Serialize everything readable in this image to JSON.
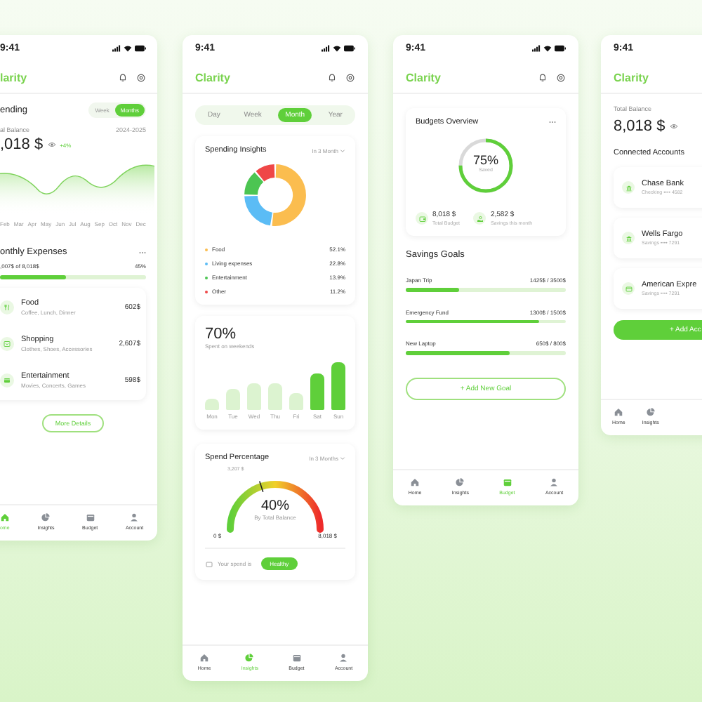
{
  "home": {
    "time": "9:41",
    "title": "larity",
    "section": "ending",
    "toggle": [
      {
        "label": "Week",
        "selected": false
      },
      {
        "label": "Months",
        "selected": true
      }
    ],
    "balance_label": "al Balance",
    "period": "2024-2025",
    "balance": ",018 $",
    "change": "+4%",
    "months": [
      "Feb",
      "Mar",
      "Apr",
      "May",
      "Jun",
      "Jul",
      "Aug",
      "Sep",
      "Oct",
      "Nov",
      "Dec"
    ],
    "expenses": {
      "title": "onthly Expenses",
      "progress_text": ",007$ of 8,018$",
      "percent": "45%",
      "level": 0.45,
      "items": [
        {
          "kind": "food",
          "name": "Food",
          "detail": "Coffee, Lunch, Dinner",
          "amount": "602$"
        },
        {
          "kind": "shopping",
          "name": "Shopping",
          "detail": "Clothes, Shoes, Accessories",
          "amount": "2,607$"
        },
        {
          "kind": "entertainment",
          "name": "Entertainment",
          "detail": "Movies, Concerts, Games",
          "amount": "598$"
        }
      ]
    },
    "button": "More Details",
    "nav": [
      {
        "kind": "home",
        "label": "ome",
        "selected": true
      },
      {
        "kind": "insights",
        "label": "Insights",
        "selected": false
      },
      {
        "kind": "budget",
        "label": "Budget",
        "selected": false
      },
      {
        "kind": "account",
        "label": "Account",
        "selected": false
      }
    ]
  },
  "insights": {
    "time": "9:41",
    "title": "Clarity",
    "segments": [
      {
        "label": "Day",
        "selected": false
      },
      {
        "label": "Week",
        "selected": false
      },
      {
        "label": "Month",
        "selected": true
      },
      {
        "label": "Year",
        "selected": false
      }
    ],
    "spending": {
      "title": "Spending Insights",
      "period": "In 3 Month",
      "chart_data": {
        "type": "donut",
        "categories": [
          "Food",
          "Living expenses",
          "Entertainment",
          "Other"
        ],
        "values": [
          52.1,
          22.8,
          13.9,
          11.2
        ]
      },
      "legend": [
        {
          "value": "52.1%",
          "color": "#fbbd4f"
        },
        {
          "value": "22.8%",
          "color": "#5bbcf5"
        },
        {
          "value": "13.9%",
          "color": "#4cc552"
        },
        {
          "value": "11.2%",
          "color": "#ef4747"
        }
      ]
    },
    "weekend": {
      "value": "70%",
      "caption": "Spent on weekends",
      "days": [
        {
          "label": "Mon",
          "highlighted": false
        },
        {
          "label": "Tue",
          "highlighted": false
        },
        {
          "label": "Wed",
          "highlighted": false
        },
        {
          "label": "Thu",
          "highlighted": false
        },
        {
          "label": "Fri",
          "highlighted": false
        },
        {
          "label": "Sat",
          "highlighted": true
        },
        {
          "label": "Sun",
          "highlighted": true
        }
      ]
    },
    "spend": {
      "title": "Spend Percentage",
      "period": "In 3 Months",
      "level": 0.4,
      "marker": "3,207 $",
      "value": "40%",
      "caption": "By Total Balance",
      "min": "0 $",
      "max": "8,018 $",
      "status_label": "Your spend is",
      "status": "Healthy"
    },
    "nav": [
      {
        "kind": "home",
        "label": "Home",
        "selected": false
      },
      {
        "kind": "insights",
        "label": "Insights",
        "selected": true
      },
      {
        "kind": "budget",
        "label": "Budget",
        "selected": false
      },
      {
        "kind": "account",
        "label": "Account",
        "selected": false
      }
    ]
  },
  "budget": {
    "time": "9:41",
    "title": "Clarity",
    "overview": {
      "title": "Budgets Overview",
      "level": 0.75,
      "value": "75%",
      "caption": "Saved",
      "stats": [
        {
          "kind": "budget",
          "value": "8,018 $",
          "label": "Total Budget"
        },
        {
          "kind": "savings",
          "value": "2,582 $",
          "label": "Savings this month"
        }
      ]
    },
    "goals": {
      "title": "Savings Goals",
      "items": [
        {
          "name": "Japan Trip",
          "amount": "1425$ / 3500$",
          "level": 0.33
        },
        {
          "name": "Emergency Fund",
          "amount": "1300$ / 1500$",
          "level": 0.83
        },
        {
          "name": "New Laptop",
          "amount": "650$ / 800$",
          "level": 0.65
        }
      ]
    },
    "button": "+ Add New Goal",
    "nav": [
      {
        "kind": "home",
        "label": "Home",
        "selected": false
      },
      {
        "kind": "insights",
        "label": "Insights",
        "selected": false
      },
      {
        "kind": "budget",
        "label": "Budget",
        "selected": true
      },
      {
        "kind": "account",
        "label": "Account",
        "selected": false
      }
    ]
  },
  "accounts": {
    "time": "9:41",
    "title": "Clarity",
    "balance_label": "Total Balance",
    "balance": "8,018 $",
    "section": "Connected Accounts",
    "items": [
      {
        "kind": "bank",
        "name": "Chase Bank",
        "detail": "Checking •••• 4582"
      },
      {
        "kind": "bank",
        "name": "Wells Fargo",
        "detail": "Savings •••• 7291"
      },
      {
        "kind": "card",
        "name": "American Expre",
        "detail": "Savings •••• 7291"
      }
    ],
    "button": "+ Add Acc",
    "nav": [
      {
        "kind": "home",
        "label": "Home",
        "selected": false
      },
      {
        "kind": "insights",
        "label": "Insights",
        "selected": false
      }
    ]
  }
}
